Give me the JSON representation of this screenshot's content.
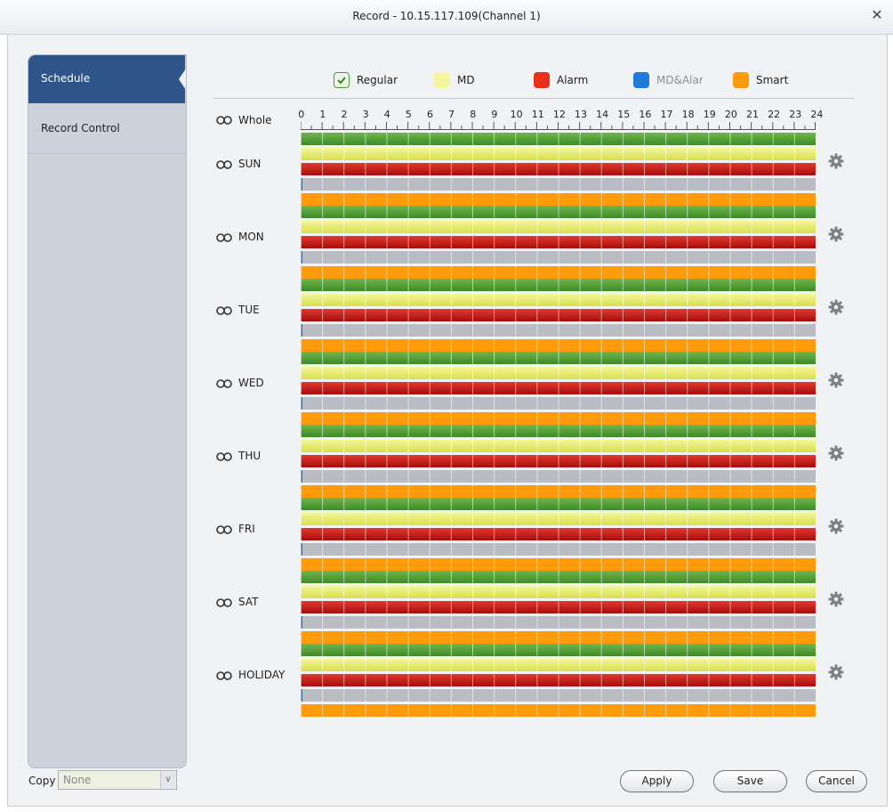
{
  "window": {
    "title": "Record - 10.15.117.109(Channel 1)"
  },
  "sidebar": {
    "items": [
      {
        "label": "Schedule"
      },
      {
        "label": "Record Control"
      }
    ]
  },
  "legend": [
    {
      "label": "Regular",
      "color": "#4a9a34",
      "checked": true
    },
    {
      "label": "MD",
      "color": "#f6f6a0"
    },
    {
      "label": "Alarm",
      "color": "#e8301a"
    },
    {
      "label": "MD&Alarm",
      "color": "#1e7bd8"
    },
    {
      "label": "Smart",
      "color": "#ff9a0a"
    }
  ],
  "whole_label": "Whole",
  "hours": [
    "0",
    "1",
    "2",
    "3",
    "4",
    "5",
    "6",
    "7",
    "8",
    "9",
    "10",
    "11",
    "12",
    "13",
    "14",
    "15",
    "16",
    "17",
    "18",
    "19",
    "20",
    "21",
    "22",
    "23",
    "24"
  ],
  "days": [
    "SUN",
    "MON",
    "TUE",
    "WED",
    "THU",
    "FRI",
    "SAT",
    "HOLIDAY"
  ],
  "copy": {
    "label": "Copy",
    "value": "None"
  },
  "buttons": {
    "apply": "Apply",
    "save": "Save",
    "cancel": "Cancel"
  }
}
